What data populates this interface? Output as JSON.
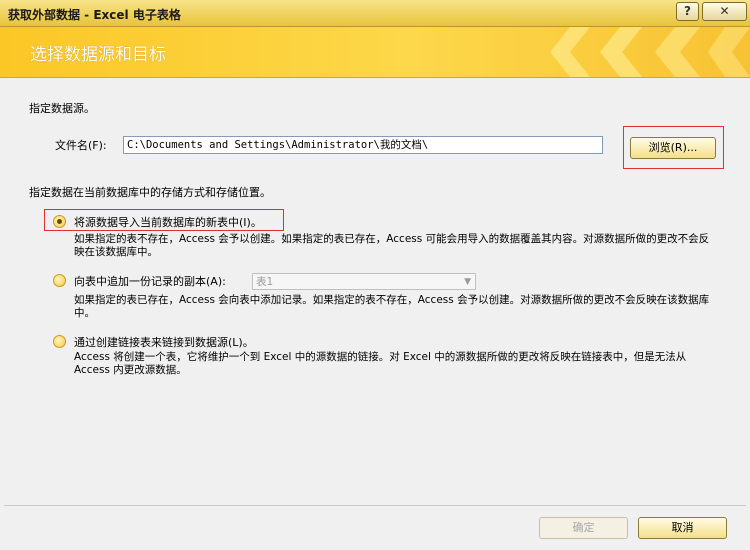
{
  "window": {
    "title": "获取外部数据 - Excel 电子表格",
    "help_label": "?",
    "close_label": "✕"
  },
  "banner": {
    "title": "选择数据源和目标"
  },
  "source": {
    "heading": "指定数据源。",
    "file_label": "文件名(F):",
    "file_value": "C:\\Documents and Settings\\Administrator\\我的文档\\",
    "browse_label": "浏览(R)..."
  },
  "storage": {
    "heading": "指定数据在当前数据库中的存储方式和存储位置。",
    "options": [
      {
        "label": "将源数据导入当前数据库的新表中(I)。",
        "desc": "如果指定的表不存在，Access 会予以创建。如果指定的表已存在，Access 可能会用导入的数据覆盖其内容。对源数据所做的更改不会反映在该数据库中。",
        "selected": true
      },
      {
        "label": "向表中追加一份记录的副本(A):",
        "combo_value": "表1",
        "desc": "如果指定的表已存在，Access 会向表中添加记录。如果指定的表不存在，Access 会予以创建。对源数据所做的更改不会反映在该数据库中。",
        "selected": false
      },
      {
        "label": "通过创建链接表来链接到数据源(L)。",
        "desc": "Access 将创建一个表，它将维护一个到 Excel 中的源数据的链接。对 Excel 中的源数据所做的更改将反映在链接表中，但是无法从 Access 内更改源数据。",
        "selected": false
      }
    ]
  },
  "footer": {
    "ok_label": "确定",
    "cancel_label": "取消"
  },
  "colors": {
    "banner": "#fbc726",
    "highlight": "#e03030"
  }
}
